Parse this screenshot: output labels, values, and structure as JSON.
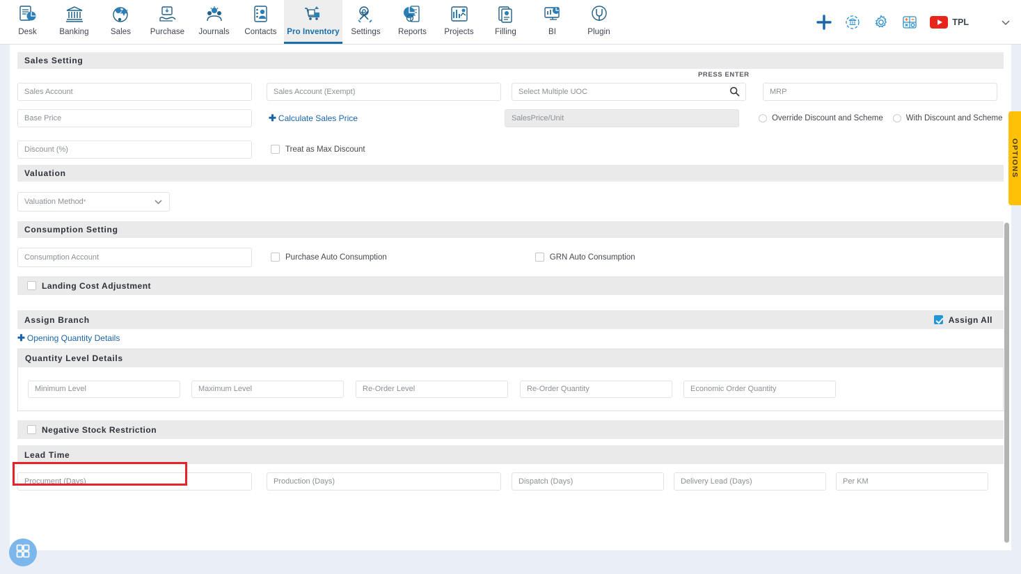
{
  "nav": {
    "items": [
      {
        "label": "Desk",
        "icon": "desk-icon",
        "active": false
      },
      {
        "label": "Banking",
        "icon": "bank-icon",
        "active": false
      },
      {
        "label": "Sales",
        "icon": "sales-icon",
        "active": false
      },
      {
        "label": "Purchase",
        "icon": "purchase-icon",
        "active": false
      },
      {
        "label": "Journals",
        "icon": "journals-icon",
        "active": false
      },
      {
        "label": "Contacts",
        "icon": "contacts-icon",
        "active": false
      },
      {
        "label": "Pro Inventory",
        "icon": "inventory-icon",
        "active": true
      },
      {
        "label": "Settings",
        "icon": "settings-tools-icon",
        "active": false
      },
      {
        "label": "Reports",
        "icon": "reports-icon",
        "active": false
      },
      {
        "label": "Projects",
        "icon": "projects-icon",
        "active": false
      },
      {
        "label": "Filling",
        "icon": "filling-icon",
        "active": false
      },
      {
        "label": "BI",
        "icon": "bi-icon",
        "active": false
      },
      {
        "label": "Plugin",
        "icon": "plugin-icon",
        "active": false
      }
    ],
    "right": {
      "add_icon": "plus-icon",
      "bank_sync_icon": "bank-refresh-icon",
      "gear_icon": "gear-icon",
      "calculator_icon": "calculator-icon",
      "youtube_icon": "youtube-icon",
      "tpl_label": "TPL",
      "chevron_icon": "chevron-down-icon"
    }
  },
  "sections": {
    "sales_setting": {
      "title": "Sales Setting",
      "press_enter": "PRESS ENTER",
      "fields": {
        "sales_account": "Sales Account",
        "sales_account_exempt": "Sales Account (Exempt)",
        "select_multiple_uoc": "Select Multiple UOC",
        "mrp": "MRP",
        "base_price": "Base Price",
        "calculate_sales_price": "Calculate Sales Price",
        "sales_price_unit": "SalesPrice/Unit",
        "discount_pct": "Discount (%)"
      },
      "radios": [
        {
          "label": "Override Discount and Scheme",
          "selected": false
        },
        {
          "label": "With Discount and Scheme",
          "selected": false
        }
      ],
      "checkboxes": [
        {
          "label": "Treat as Max Discount",
          "checked": false
        }
      ],
      "search_icon": "search-icon"
    },
    "valuation": {
      "title": "Valuation",
      "method_label": "Valuation Method",
      "method_required_marker": "*",
      "chevron_icon": "chevron-down-icon"
    },
    "consumption_setting": {
      "title": "Consumption Setting",
      "account_placeholder": "Consumption Account",
      "checkboxes": [
        {
          "label": "Purchase Auto Consumption",
          "checked": false
        },
        {
          "label": "GRN Auto Consumption",
          "checked": false
        }
      ]
    },
    "landing_cost": {
      "label": "Landing Cost Adjustment",
      "checked": false
    },
    "assign_branch": {
      "title": "Assign Branch",
      "assign_all_label": "Assign All",
      "assign_all_checked": true,
      "opening_quantity_details": "Opening Quantity Details"
    },
    "quantity_level": {
      "title": "Quantity Level Details",
      "fields": [
        "Minimum Level",
        "Maximum Level",
        "Re-Order Level",
        "Re-Order Quantity",
        "Economic Order Quantity"
      ]
    },
    "negative_stock": {
      "label": "Negative Stock Restriction",
      "checked": false,
      "highlighted": true,
      "highlight_color": "#e8222a"
    },
    "lead_time": {
      "title": "Lead Time",
      "fields": [
        "Procument (Days)",
        "Production (Days)",
        "Dispatch (Days)",
        "Delivery Lead (Days)",
        "Per KM"
      ]
    }
  },
  "options_tab": {
    "label": "OPTIONS",
    "color": "#ffc107"
  },
  "fab": {
    "icon": "grid-apps-icon",
    "color": "#7cb7ec"
  },
  "theme": {
    "accent": "#1a6fa8",
    "link": "#1a64a8",
    "checkbox_checked": "#2196d4",
    "page_bg": "#e9eef7",
    "section_bar": "#eaeaea"
  }
}
